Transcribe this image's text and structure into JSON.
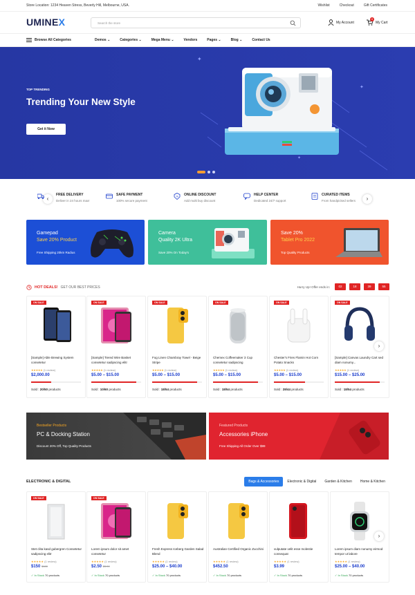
{
  "topbar": {
    "location": "Store Location: 1234 Heaven Stress, Beverly Hill, Melbourne, USA.",
    "links": [
      "Wishlist",
      "Checkout",
      "Gift Certificates"
    ]
  },
  "header": {
    "logo_main": "UMINE",
    "logo_accent": "X",
    "search_placeholder": "Search the store",
    "account_label": "My Account",
    "cart_label": "My Cart",
    "cart_count": "0"
  },
  "nav": {
    "browse_label": "Browse All Categories",
    "items": [
      "Demos",
      "Categories",
      "Mega Menu",
      "Vendors",
      "Pages",
      "Blog",
      "Contact Us"
    ]
  },
  "hero": {
    "eyebrow": "TOP TRENDING",
    "title": "Trending Your New Style",
    "button": "Get it Now"
  },
  "features": [
    {
      "title": "FREE DELIVERY",
      "sub": "Deliver in 24 hours max!"
    },
    {
      "title": "SAFE PAYMENT",
      "sub": "100% secure payment"
    },
    {
      "title": "ONLINE DISCOUNT",
      "sub": "Add multi buy discount"
    },
    {
      "title": "HELP CENTER",
      "sub": "Dedicated 24/7 support"
    },
    {
      "title": "CURATED ITEMS",
      "sub": "From handpicked sellers"
    }
  ],
  "promos": [
    {
      "line1": "Gamepad",
      "line2": "Save 20% Product",
      "sub": "Free Shipping 20km Radius",
      "color": "#1c4fd6"
    },
    {
      "line1": "Camera",
      "line2": "Quality 2K Ultra",
      "sub": "Save 20% On Today's",
      "color": "#3fbf9a"
    },
    {
      "line1": "Save 20%",
      "line2": "Tablet Pro 2022",
      "sub": "Top Quality Products",
      "color": "#f0542d"
    }
  ],
  "deals": {
    "title": "HOT DEALS!",
    "subtitle": "GET OUR BEST PRICES",
    "timer_label": "Hurry Up! Offer ends in:",
    "timer": [
      "02",
      "18",
      "39",
      "55"
    ],
    "products": [
      {
        "badge": "ON SALE",
        "name": "[Sample] Able Brewing System consetetur",
        "rating": "(1 review)",
        "price": "$2,000.00",
        "old": "",
        "sold": "20/50",
        "fill": 0.4
      },
      {
        "badge": "ON SALE",
        "name": "[Sample] Tiered Wire Basket consetetur sadipscing elitr",
        "rating": "(1 review)",
        "price": "$5.00 – $15.00",
        "old": "",
        "sold": "10/60",
        "fill": 0.9
      },
      {
        "badge": "ON SALE",
        "name": "Fog Linen Chambray Towel - Beige Stripe",
        "rating": "(1 review)",
        "price": "$5.00 – $15.00",
        "old": "",
        "sold": "18/54",
        "fill": 0.9
      },
      {
        "badge": "ON SALE",
        "name": "Chemex Coffeemaker 3 Cup consetetur sadipscing",
        "rating": "(1 review)",
        "price": "$5.00 – $15.00",
        "old": "",
        "sold": "18/54",
        "fill": 0.9
      },
      {
        "badge": "ON SALE",
        "name": "Chester's Fries Flamin Hot Corn Potato Snacks",
        "rating": "(1 review)",
        "price": "$5.00 – $15.00",
        "old": "",
        "sold": "28/44",
        "fill": 0.62
      },
      {
        "badge": "ON SALE",
        "name": "[Sample] Canvas Laundry Cart sed diam nonumy...",
        "rating": "(1 review)",
        "price": "$15.00 – $25.00",
        "old": "",
        "sold": "18/54",
        "fill": 0.9
      }
    ],
    "sold_prefix": "Sold :",
    "sold_suffix": "products"
  },
  "banners": [
    {
      "eyebrow": "Bestseller Products",
      "title": "PC & Docking Station",
      "sub": "Discount 20% Off, Top Quality Products",
      "color": "#3a3a3a",
      "accent": "#f5a623"
    },
    {
      "eyebrow": "Featured Products",
      "title": "Accessories iPhone",
      "sub": "Free Shipping All Order Over $99",
      "color": "#e0242f",
      "accent": "#ffd0d0"
    }
  ],
  "electronic": {
    "title": "ELECTRONIC & DIGITAL",
    "tabs": [
      "Bags & Accessories",
      "Electronic & Digital",
      "Garden & Kitchen",
      "Home & Kitchen"
    ],
    "products": [
      {
        "badge": "ON SALE",
        "name": "Stet clita kasd gubergren Consetetur sadipscing elitr",
        "rating": "(1 review)",
        "price": "$150",
        "old": "$180",
        "stock": "70"
      },
      {
        "badge": "ON SALE",
        "name": "Lorem ipsum dolor sit amet consetetur",
        "rating": "(1 review)",
        "price": "$2.50",
        "old": "$3.00",
        "stock": "70"
      },
      {
        "badge": "",
        "name": "Fresh Express Iceberg Garden Salad Blend",
        "rating": "(1 review)",
        "price": "$25.00 – $40.00",
        "old": "",
        "stock": "70"
      },
      {
        "badge": "",
        "name": "Australian Certified Organic Zucchini",
        "rating": "(1 review)",
        "price": "$452.50",
        "old": "",
        "stock": "70"
      },
      {
        "badge": "",
        "name": "vulputate velit esse molestie consequat",
        "rating": "(1 review)",
        "price": "$3.99",
        "old": "",
        "stock": "70"
      },
      {
        "badge": "",
        "name": "Lorem ipsum diam nonumy eirmod tempor ut labore",
        "rating": "(1 review)",
        "price": "$25.00 – $40.00",
        "old": "",
        "stock": "70"
      }
    ],
    "stock_label": "In Stock",
    "stock_suffix": "products"
  }
}
